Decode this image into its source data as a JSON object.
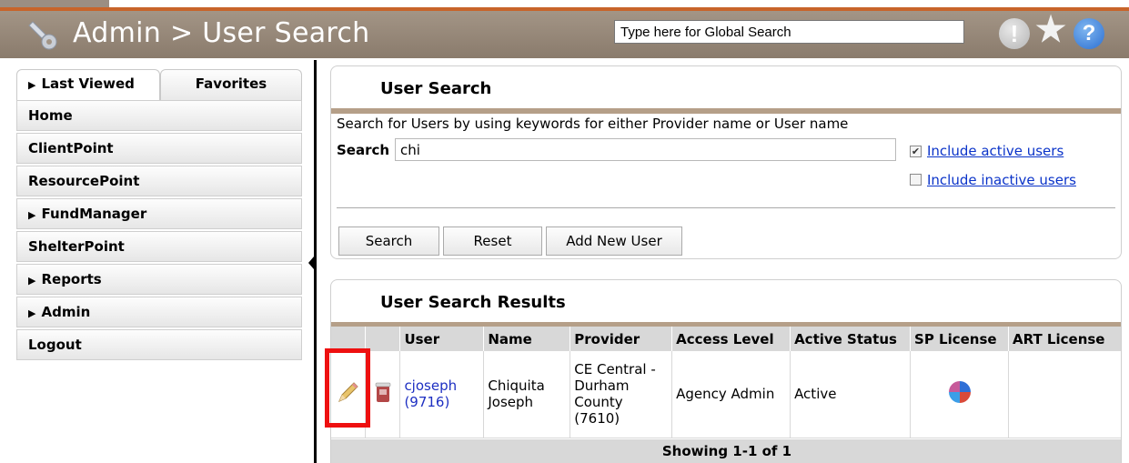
{
  "header": {
    "title": "Admin > User Search",
    "global_search_placeholder": "Type here for Global Search"
  },
  "sidebar": {
    "tabs": [
      "Last Viewed",
      "Favorites"
    ],
    "items": [
      "Home",
      "ClientPoint",
      "ResourcePoint",
      "FundManager",
      "ShelterPoint",
      "Reports",
      "Admin",
      "Logout"
    ]
  },
  "search_panel": {
    "title": "User Search",
    "description": "Search for Users by using keywords for either Provider name or User name",
    "search_label": "Search",
    "search_value": "chi",
    "include_active_label": "Include active users",
    "include_active_checked": true,
    "include_inactive_label": "Include inactive users",
    "include_inactive_checked": false,
    "buttons": {
      "search": "Search",
      "reset": "Reset",
      "add_new_user": "Add New User"
    }
  },
  "results_panel": {
    "title": "User Search Results",
    "columns": [
      "User",
      "Name",
      "Provider",
      "Access Level",
      "Active Status",
      "SP License",
      "ART License"
    ],
    "rows": [
      {
        "user": "cjoseph (9716)",
        "name": "Chiquita Joseph",
        "provider": "CE Central - Durham County (7610)",
        "access_level": "Agency Admin",
        "active_status": "Active",
        "sp_license_icon": "license-icon",
        "art_license": ""
      }
    ],
    "showing": "Showing 1-1 of 1"
  },
  "icons": {
    "edit": "pencil-icon",
    "delete": "trash-icon",
    "alert": "exclamation-icon",
    "favorite": "star-icon",
    "help": "question-icon"
  },
  "colors": {
    "header_bg": "#9a8b7c",
    "accent_orange": "#c8642a",
    "panel_bar": "#b59f88",
    "link": "#1d2fc2",
    "highlight": "#ee1010"
  }
}
